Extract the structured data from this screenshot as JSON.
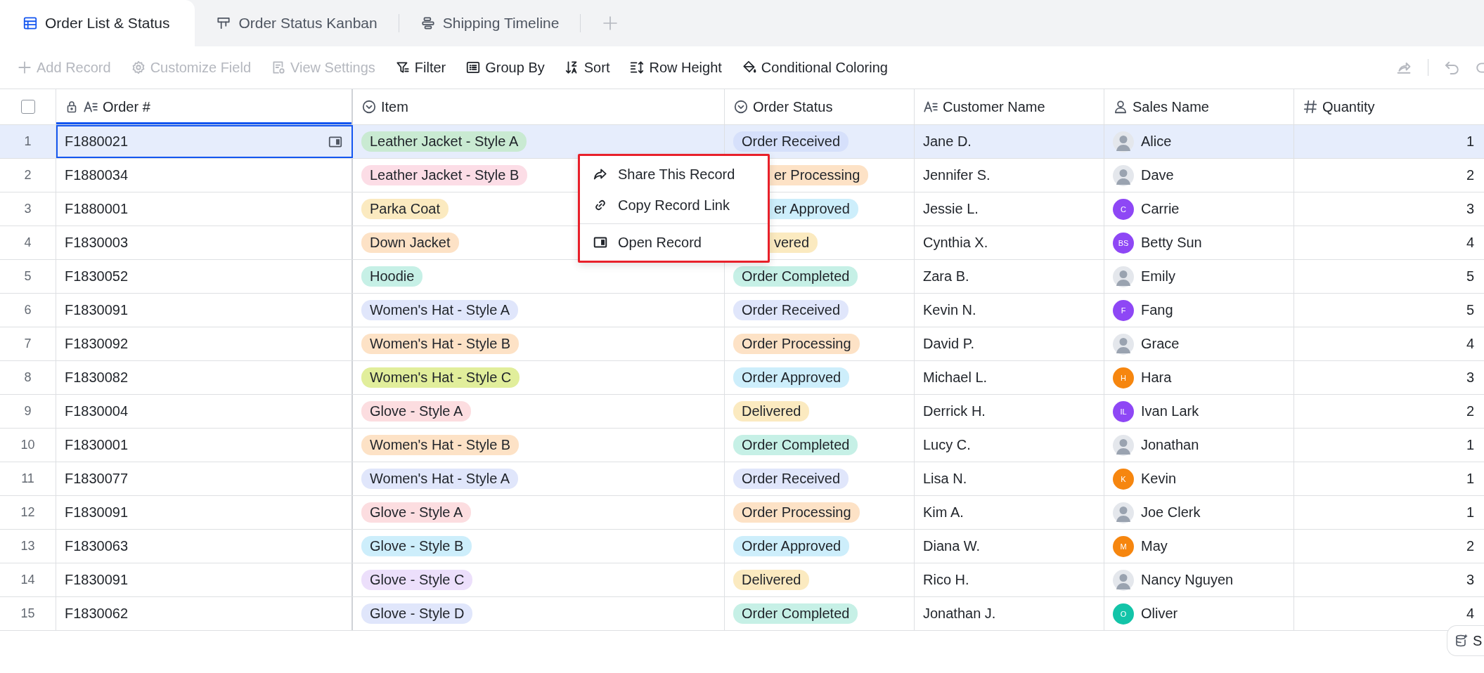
{
  "tabs": [
    {
      "label": "Order List & Status",
      "kind": "grid",
      "selected": true
    },
    {
      "label": "Order Status Kanban",
      "kind": "kanban",
      "selected": false
    },
    {
      "label": "Shipping Timeline",
      "kind": "timeline",
      "selected": false
    }
  ],
  "toolbar": {
    "items": [
      {
        "label": "Add Record",
        "kind": "add",
        "disabled": true
      },
      {
        "label": "Customize Field",
        "kind": "gear",
        "disabled": true
      },
      {
        "label": "View Settings",
        "kind": "view",
        "disabled": true
      },
      {
        "label": "Filter",
        "kind": "filter",
        "disabled": false
      },
      {
        "label": "Group By",
        "kind": "group",
        "disabled": false
      },
      {
        "label": "Sort",
        "kind": "sort",
        "disabled": false
      },
      {
        "label": "Row Height",
        "kind": "height",
        "disabled": false
      },
      {
        "label": "Conditional Coloring",
        "kind": "paint",
        "disabled": false
      }
    ]
  },
  "table": {
    "select_all": {
      "checked": false
    },
    "columns": [
      {
        "label": "Order #",
        "kind": "text",
        "locked": true,
        "selected": true
      },
      {
        "label": "Item",
        "kind": "select",
        "locked": false,
        "selected": false
      },
      {
        "label": "Order Status",
        "kind": "select",
        "locked": false,
        "selected": false
      },
      {
        "label": "Customer Name",
        "kind": "text",
        "locked": false,
        "selected": false
      },
      {
        "label": "Sales Name",
        "kind": "person",
        "locked": false,
        "selected": false
      },
      {
        "label": "Quantity",
        "kind": "number",
        "locked": false,
        "selected": false
      }
    ],
    "rows": [
      {
        "number": "1",
        "selected": true,
        "order": "F1880021",
        "item": {
          "text": "Leather Jacket - Style A",
          "color": "#c9ead2"
        },
        "status": {
          "text": "Order Received",
          "color": "#d6e0fb",
          "covered": false
        },
        "customer": "Jane D.",
        "sales": {
          "name": "Alice",
          "kind": "photo"
        },
        "quantity": "1"
      },
      {
        "number": "2",
        "selected": false,
        "order": "F1880034",
        "item": {
          "text": "Leather Jacket - Style B",
          "color": "#fcdde6"
        },
        "status": {
          "text": "er Processing",
          "color": "#fde2c6",
          "covered": true
        },
        "customer": "Jennifer S.",
        "sales": {
          "name": "Dave",
          "kind": "photo"
        },
        "quantity": "2"
      },
      {
        "number": "3",
        "selected": false,
        "order": "F1880001",
        "item": {
          "text": "Parka Coat",
          "color": "#fbeac0"
        },
        "status": {
          "text": "er Approved",
          "color": "#cdeefb",
          "covered": true
        },
        "customer": "Jessie L.",
        "sales": {
          "name": "Carrie",
          "kind": "initials",
          "initials": "C",
          "color": "#8e47f5"
        },
        "quantity": "3"
      },
      {
        "number": "4",
        "selected": false,
        "order": "F1830003",
        "item": {
          "text": "Down Jacket",
          "color": "#fde2c6"
        },
        "status": {
          "text": "vered",
          "color": "#fbeac0",
          "covered": true
        },
        "customer": "Cynthia X.",
        "sales": {
          "name": "Betty Sun",
          "kind": "initials",
          "initials": "BS",
          "color": "#8e47f5"
        },
        "quantity": "4"
      },
      {
        "number": "5",
        "selected": false,
        "order": "F1830052",
        "item": {
          "text": "Hoodie",
          "color": "#c6f0e6"
        },
        "status": {
          "text": "Order Completed",
          "color": "#c6f0e6",
          "covered": false
        },
        "customer": "Zara B.",
        "sales": {
          "name": "Emily",
          "kind": "photo"
        },
        "quantity": "5"
      },
      {
        "number": "6",
        "selected": false,
        "order": "F1830091",
        "item": {
          "text": "Women's Hat - Style A",
          "color": "#e0e6fb"
        },
        "status": {
          "text": "Order Received",
          "color": "#e0e6fb",
          "covered": false
        },
        "customer": "Kevin N.",
        "sales": {
          "name": "Fang",
          "kind": "initials",
          "initials": "F",
          "color": "#8e47f5"
        },
        "quantity": "5"
      },
      {
        "number": "7",
        "selected": false,
        "order": "F1830092",
        "item": {
          "text": "Women's Hat - Style B",
          "color": "#fde2c6"
        },
        "status": {
          "text": "Order Processing",
          "color": "#fde2c6",
          "covered": false
        },
        "customer": "David P.",
        "sales": {
          "name": "Grace",
          "kind": "photo"
        },
        "quantity": "4"
      },
      {
        "number": "8",
        "selected": false,
        "order": "F1830082",
        "item": {
          "text": "Women's Hat - Style C",
          "color": "#e1ee9b"
        },
        "status": {
          "text": "Order Approved",
          "color": "#cdeefb",
          "covered": false
        },
        "customer": "Michael L.",
        "sales": {
          "name": "Hara",
          "kind": "initials",
          "initials": "H",
          "color": "#f6860f"
        },
        "quantity": "3"
      },
      {
        "number": "9",
        "selected": false,
        "order": "F1830004",
        "item": {
          "text": "Glove - Style A",
          "color": "#fcdde0"
        },
        "status": {
          "text": "Delivered",
          "color": "#fbeac0",
          "covered": false
        },
        "customer": "Derrick H.",
        "sales": {
          "name": "Ivan Lark",
          "kind": "initials",
          "initials": "IL",
          "color": "#8e47f5"
        },
        "quantity": "2"
      },
      {
        "number": "10",
        "selected": false,
        "order": "F1830001",
        "item": {
          "text": "Women's Hat - Style B",
          "color": "#fde2c6"
        },
        "status": {
          "text": "Order Completed",
          "color": "#c6f0e6",
          "covered": false
        },
        "customer": "Lucy C.",
        "sales": {
          "name": "Jonathan",
          "kind": "photo"
        },
        "quantity": "1"
      },
      {
        "number": "11",
        "selected": false,
        "order": "F1830077",
        "item": {
          "text": "Women's Hat - Style A",
          "color": "#e0e6fb"
        },
        "status": {
          "text": "Order Received",
          "color": "#e0e6fb",
          "covered": false
        },
        "customer": "Lisa N.",
        "sales": {
          "name": "Kevin",
          "kind": "initials",
          "initials": "K",
          "color": "#f6860f"
        },
        "quantity": "1"
      },
      {
        "number": "12",
        "selected": false,
        "order": "F1830091",
        "item": {
          "text": "Glove - Style A",
          "color": "#fcdde0"
        },
        "status": {
          "text": "Order Processing",
          "color": "#fde2c6",
          "covered": false
        },
        "customer": "Kim A.",
        "sales": {
          "name": "Joe Clerk",
          "kind": "photo"
        },
        "quantity": "1"
      },
      {
        "number": "13",
        "selected": false,
        "order": "F1830063",
        "item": {
          "text": "Glove - Style B",
          "color": "#cdeefb"
        },
        "status": {
          "text": "Order Approved",
          "color": "#cdeefb",
          "covered": false
        },
        "customer": "Diana W.",
        "sales": {
          "name": "May",
          "kind": "initials",
          "initials": "M",
          "color": "#f6860f"
        },
        "quantity": "2"
      },
      {
        "number": "14",
        "selected": false,
        "order": "F1830091",
        "item": {
          "text": "Glove - Style C",
          "color": "#ecdffb"
        },
        "status": {
          "text": "Delivered",
          "color": "#fbeac0",
          "covered": false
        },
        "customer": "Rico H.",
        "sales": {
          "name": "Nancy Nguyen",
          "kind": "photo"
        },
        "quantity": "3"
      },
      {
        "number": "15",
        "selected": false,
        "order": "F1830062",
        "item": {
          "text": "Glove - Style D",
          "color": "#e0e6fb"
        },
        "status": {
          "text": "Order Completed",
          "color": "#c6f0e6",
          "covered": false
        },
        "customer": "Jonathan J.",
        "sales": {
          "name": "Oliver",
          "kind": "initials",
          "initials": "O",
          "color": "#13c4a8"
        },
        "quantity": "4"
      }
    ]
  },
  "context_menu": {
    "items": [
      {
        "label": "Share This Record",
        "kind": "share"
      },
      {
        "label": "Copy Record Link",
        "kind": "link"
      },
      {
        "label": "Open Record",
        "kind": "open"
      }
    ]
  },
  "floating_button": {
    "label": "S"
  }
}
